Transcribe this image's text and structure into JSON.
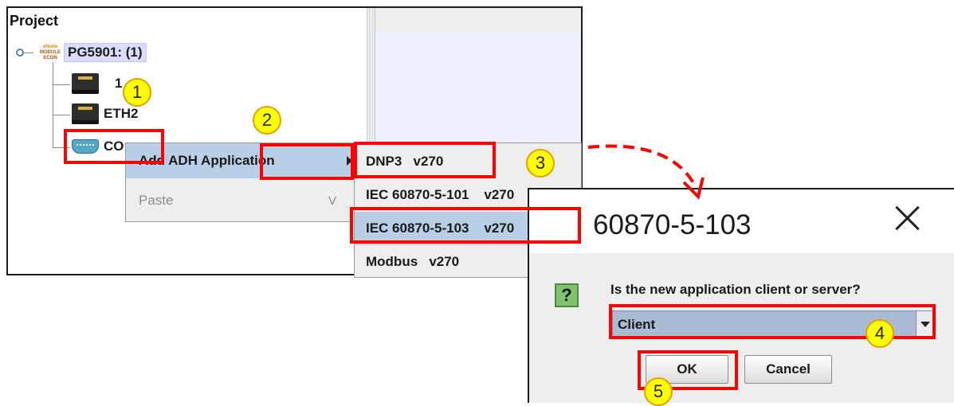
{
  "tree": {
    "title": "Project",
    "root": {
      "label": "PG5901: (1)",
      "icon": "econ-device-icon",
      "icon_lines": [
        "eNode",
        "MODULE",
        "ECON"
      ]
    },
    "children": [
      {
        "label": "ETH1",
        "visible": "1",
        "icon": "ethernet-port-icon"
      },
      {
        "label": "ETH2",
        "visible": "ETH2",
        "icon": "ethernet-port-icon"
      },
      {
        "label": "COM1",
        "visible": "CO",
        "icon": "serial-port-icon"
      }
    ]
  },
  "context_menu": {
    "items": [
      {
        "label": "Add ADH Application",
        "visible": "Add ADH Application",
        "state": "active",
        "has_submenu": true
      },
      {
        "label": "Paste",
        "shortcut": "V",
        "state": "disabled"
      }
    ]
  },
  "submenu": {
    "items": [
      {
        "label": "DNP3   v270"
      },
      {
        "label": "IEC 60870-5-101    v270"
      },
      {
        "label": "IEC 60870-5-103    v270",
        "selected": true
      },
      {
        "label": "Modbus   v270"
      }
    ]
  },
  "dialog": {
    "title": "60870-5-103",
    "message": "Is the new application client or server?",
    "selected_option": "Client",
    "ok_label": "OK",
    "cancel_label": "Cancel",
    "icon": "question-icon"
  },
  "annotations": {
    "steps": [
      "1",
      "2",
      "3",
      "4",
      "5"
    ],
    "highlight_color": "#ff0000",
    "marker_color": "#ffff00"
  }
}
